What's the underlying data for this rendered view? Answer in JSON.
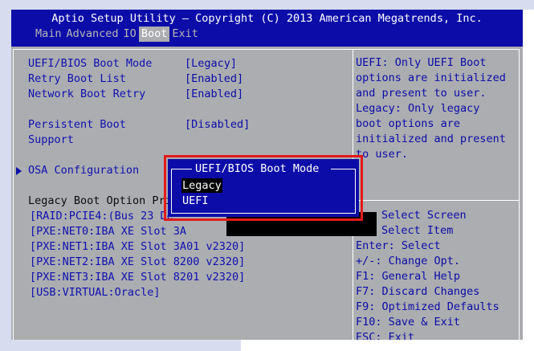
{
  "title": "Aptio Setup Utility – Copyright (C) 2013 American Megatrends, Inc.",
  "tabs": [
    {
      "label": "Main"
    },
    {
      "label": "Advanced"
    },
    {
      "label": "IO"
    },
    {
      "label": "Boot"
    },
    {
      "label": "Exit"
    }
  ],
  "active_tab": "Boot",
  "settings": [
    {
      "label": "UEFI/BIOS Boot Mode",
      "value": "[Legacy]"
    },
    {
      "label": "Retry Boot List",
      "value": "[Enabled]"
    },
    {
      "label": "Network Boot Retry",
      "value": "[Enabled]"
    },
    {
      "label_line1": "Persistent Boot",
      "label_line2": "Support",
      "value": "[Disabled]"
    }
  ],
  "submenu": {
    "label": "OSA Configuration"
  },
  "boot_priorities": {
    "header": "Legacy Boot Option Pri",
    "items": [
      "[RAID:PCIE4:(Bus 23 De",
      "[PXE:NET0:IBA XE Slot 3A",
      "[PXE:NET1:IBA XE Slot 3A01 v2320]",
      "[PXE:NET2:IBA XE Slot 8200 v2320]",
      "[PXE:NET3:IBA XE Slot 8201 v2320]",
      "[USB:VIRTUAL:Oracle]"
    ]
  },
  "help_text": [
    "UEFI: Only UEFI Boot",
    "options are initialized",
    "and present to user.",
    "Legacy: Only legacy",
    "boot options are",
    "initialized and present",
    "to user."
  ],
  "key_help": [
    "Select Screen",
    "Select Item",
    "Enter: Select",
    "+/-: Change Opt.",
    "F1: General Help",
    "F7: Discard Changes",
    "F9: Optimized Defaults",
    "F10: Save & Exit",
    "ESC: Exit"
  ],
  "popup": {
    "title": "UEFI/BIOS Boot Mode",
    "options": [
      "Legacy",
      "UEFI"
    ],
    "selected": "Legacy"
  },
  "colors": {
    "bios_blue": "#0c0ca8",
    "bios_gray": "#abadb0",
    "highlight_red": "#e11a1a"
  }
}
